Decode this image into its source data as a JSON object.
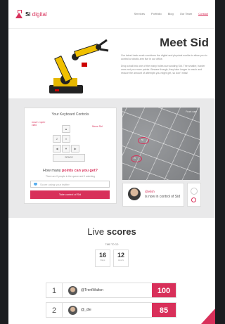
{
  "nav": {
    "logo_mark": "Si",
    "logo_suffix": "digital",
    "links": [
      "Services",
      "Portfolio",
      "Blog",
      "Our Team",
      "Contact"
    ]
  },
  "hero": {
    "title_light": "Meet",
    "title_bold": "Sid",
    "paragraph1": "Our latest hack week combines the digital and physical worlds to allow you to control a robotic arm live in our office.",
    "paragraph2": "Drop a ball into one of the many holes surrounding Sid. The smaller, harder ones net you more points. Beware though, they take longer to reach and reduce the amount of attempts you might get, so don't miss!"
  },
  "keyboard": {
    "title": "Your Keyboard Controls",
    "note_left": "move / open claw",
    "note_right": "Move Sid",
    "keys": {
      "z": "Z",
      "x": "X",
      "up": "▲",
      "left": "◀",
      "down": "▼",
      "right": "▶"
    },
    "space_label": "SPACE",
    "points_question_prefix": "How many",
    "points_question_highlight": "points can you get?",
    "points_sub": "There are 0 people in the queue and 0 watching",
    "twitter_placeholder": "Score using your twitter",
    "take_control_label": "Take control of Sid"
  },
  "camera": {
    "label": "Front cam",
    "ring_labels": [
      "50",
      "25"
    ]
  },
  "controller": {
    "username": "@elish",
    "message": "is now in control of Sid"
  },
  "scores": {
    "title_light": "Live",
    "title_bold": "scores",
    "time_to_go": "TIME TO GO",
    "days_value": "16",
    "days_label": "Days",
    "hours_value": "12",
    "hours_label": "Hours",
    "rows": [
      {
        "rank": "1",
        "name": "@TrentWalton",
        "score": "100"
      },
      {
        "rank": "2",
        "name": "@_dte",
        "score": "85"
      }
    ]
  },
  "colors": {
    "accent": "#d8305a",
    "section_bg": "#e9e9ea",
    "page_bg": "#1b1d20"
  }
}
